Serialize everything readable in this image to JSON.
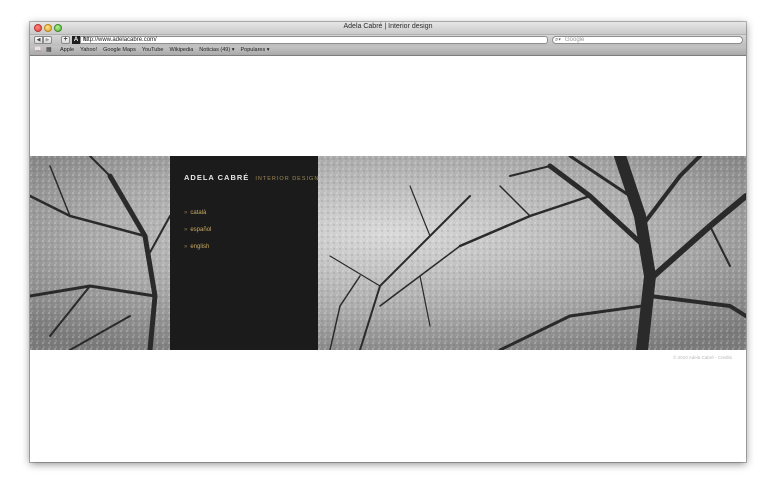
{
  "window": {
    "title": "Adela Cabré | Interior design"
  },
  "toolbar": {
    "url": "http://www.adelacabre.com/",
    "search_placeholder": "Google",
    "favicon_letter": "A"
  },
  "bookmarks": [
    "Apple",
    "Yahoo!",
    "Google Maps",
    "YouTube",
    "Wikipedia",
    "Noticias (49) ▾",
    "Populares ▾"
  ],
  "site": {
    "brand_name": "ADELA CABRÉ",
    "brand_subtitle": "INTERIOR DESIGN",
    "languages": [
      "català",
      "español",
      "english"
    ],
    "footer": "© 2010 Adela Cabré · Credits"
  },
  "colors": {
    "panel": "#1b1b1b",
    "link": "#c7ab63",
    "subtitle": "#a08a55"
  }
}
